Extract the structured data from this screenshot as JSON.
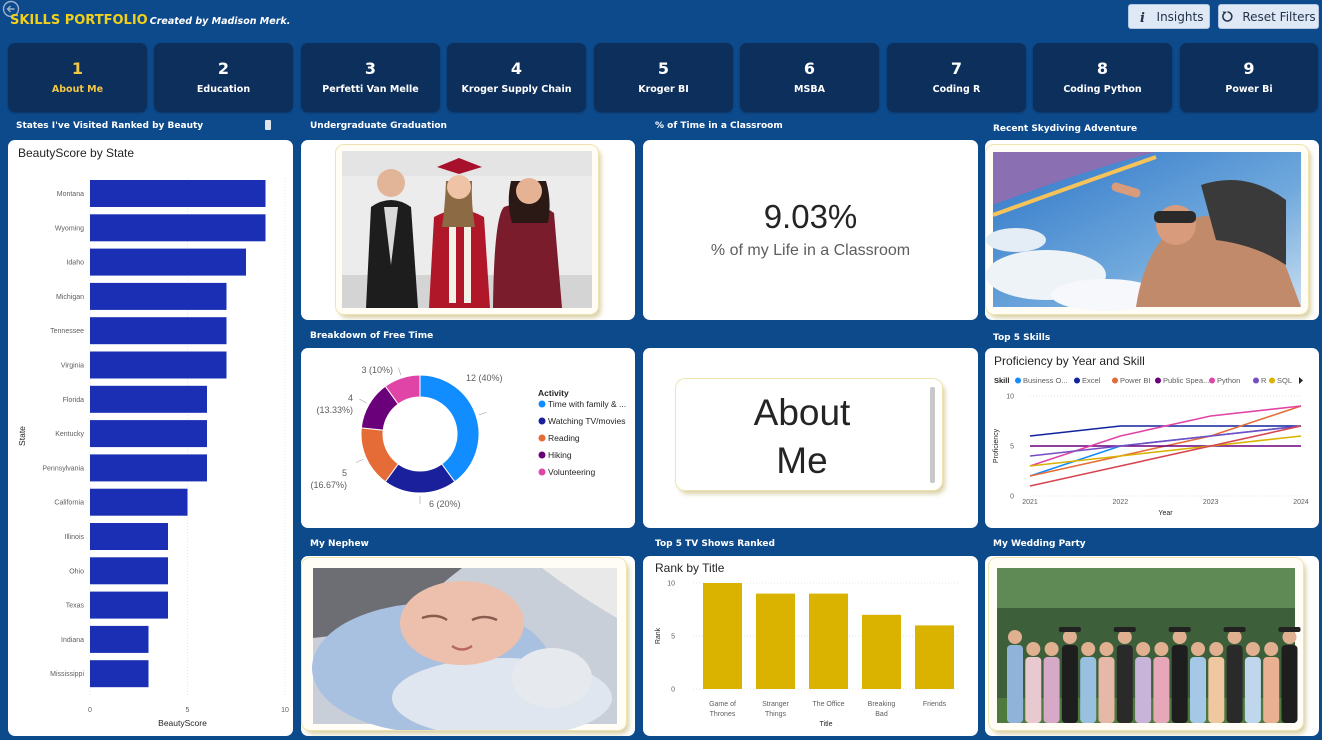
{
  "header": {
    "title": "SKILLS PORTFOLIO",
    "subtitle": "Created by Madison Merk.",
    "insights_label": "Insights",
    "reset_label": "Reset Filters"
  },
  "nav": [
    {
      "num": "1",
      "label": "About Me",
      "active": true
    },
    {
      "num": "2",
      "label": "Education"
    },
    {
      "num": "3",
      "label": "Perfetti Van Melle"
    },
    {
      "num": "4",
      "label": "Kroger Supply Chain"
    },
    {
      "num": "5",
      "label": "Kroger BI"
    },
    {
      "num": "6",
      "label": "MSBA"
    },
    {
      "num": "7",
      "label": "Coding R"
    },
    {
      "num": "8",
      "label": "Coding Python"
    },
    {
      "num": "9",
      "label": "Power Bi"
    }
  ],
  "sections": {
    "states": "States I've Visited Ranked by Beauty",
    "graduation": "Undergraduate Graduation",
    "classroom": "% of Time in a Classroom",
    "skydiving": "Recent Skydiving Adventure",
    "free_time": "Breakdown of Free Time",
    "skills": "Top 5 Skills",
    "nephew": "My Nephew",
    "tv": "Top 5 TV Shows Ranked",
    "wedding": "My Wedding Party"
  },
  "kpi": {
    "value": "9.03%",
    "label": "% of my Life in a Classroom"
  },
  "about_box": {
    "line1": "About",
    "line2": "Me"
  },
  "chart_data": [
    {
      "type": "bar",
      "orientation": "horizontal",
      "title": "BeautyScore by State",
      "xlabel": "BeautyScore",
      "ylabel": "State",
      "xlim": [
        0,
        10
      ],
      "xticks": [
        0,
        5,
        10
      ],
      "categories": [
        "Montana",
        "Wyoming",
        "Idaho",
        "Michigan",
        "Tennessee",
        "Virginia",
        "Florida",
        "Kentucky",
        "Pennsylvania",
        "California",
        "Illinois",
        "Ohio",
        "Texas",
        "Indiana",
        "Mississippi"
      ],
      "values": [
        9,
        9,
        8,
        7,
        7,
        7,
        6,
        6,
        6,
        5,
        4,
        4,
        4,
        3,
        3
      ],
      "color": "#1a2fb4"
    },
    {
      "type": "pie",
      "donut": true,
      "legend_title": "Activity",
      "slices": [
        {
          "name": "Time with family & ...",
          "value": 12,
          "label_value": "12 (40%)",
          "color": "#118dff"
        },
        {
          "name": "Watching TV/movies",
          "value": 6,
          "label_value": "6 (20%)",
          "color": "#1a1f9c"
        },
        {
          "name": "Reading",
          "value": 5,
          "label_value": "5 (16.67%)",
          "color": "#e66c37"
        },
        {
          "name": "Hiking",
          "value": 4,
          "label_value": "4 (13.33%)",
          "color": "#6b007b"
        },
        {
          "name": "Volunteering",
          "value": 3,
          "label_value": "3 (10%)",
          "color": "#e044a7"
        }
      ]
    },
    {
      "type": "line",
      "title": "Proficiency by Year and Skill",
      "xlabel": "Year",
      "ylabel": "Proficiency",
      "legend_title": "Skill",
      "x": [
        2021,
        2022,
        2023,
        2024
      ],
      "ylim": [
        0,
        10
      ],
      "yticks": [
        0,
        5,
        10
      ],
      "series": [
        {
          "name": "Business O...",
          "color": "#118dff",
          "values": [
            2,
            5,
            6,
            7
          ]
        },
        {
          "name": "Excel",
          "color": "#12239e",
          "values": [
            6,
            7,
            7,
            7
          ]
        },
        {
          "name": "Power BI",
          "color": "#e66c37",
          "values": [
            2,
            4,
            6,
            9
          ]
        },
        {
          "name": "Public Spea...",
          "color": "#6b007b",
          "values": [
            5,
            5,
            5,
            5
          ]
        },
        {
          "name": "Python",
          "color": "#e044a7",
          "values": [
            3,
            6,
            8,
            9
          ]
        },
        {
          "name": "R",
          "color": "#744ec2",
          "values": [
            4,
            5,
            6,
            7
          ]
        },
        {
          "name": "SQL",
          "color": "#d9b300",
          "values": [
            3,
            4,
            5,
            6
          ]
        },
        {
          "name": "",
          "color": "#d64550",
          "values": [
            1,
            3,
            5,
            7
          ]
        }
      ]
    },
    {
      "type": "bar",
      "title": "Rank by Title",
      "xlabel": "Title",
      "ylabel": "Rank",
      "ylim": [
        0,
        10
      ],
      "yticks": [
        0,
        5,
        10
      ],
      "categories": [
        "Game of Thrones",
        "Stranger Things",
        "The Office",
        "Breaking Bad",
        "Friends"
      ],
      "categories_display": [
        [
          "Game of",
          "Thrones"
        ],
        [
          "Stranger",
          "Things"
        ],
        [
          "The Office"
        ],
        [
          "Breaking",
          "Bad"
        ],
        [
          "Friends"
        ]
      ],
      "values": [
        10,
        9,
        9,
        7,
        6
      ],
      "color": "#d9b300"
    }
  ]
}
